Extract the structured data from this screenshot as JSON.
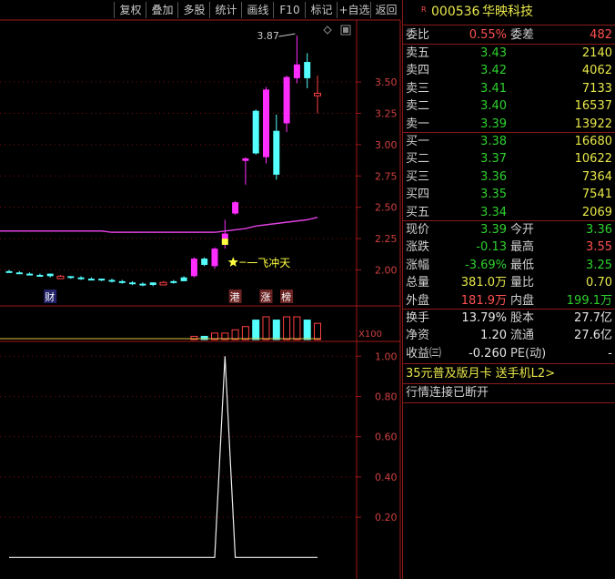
{
  "toolbar": {
    "buttons": [
      "复权",
      "叠加",
      "多股",
      "统计",
      "画线",
      "F10",
      "标记",
      "+自选",
      "返回"
    ]
  },
  "stock": {
    "prefix": "R",
    "code": "000536",
    "name": "华映科技"
  },
  "ratio": {
    "label": "委比",
    "value": "0.55%",
    "diff_label": "委差",
    "diff_value": "482"
  },
  "sell": [
    {
      "label": "卖五",
      "price": "3.43",
      "volume": "2140"
    },
    {
      "label": "卖四",
      "price": "3.42",
      "volume": "4062"
    },
    {
      "label": "卖三",
      "price": "3.41",
      "volume": "7133"
    },
    {
      "label": "卖二",
      "price": "3.40",
      "volume": "16537"
    },
    {
      "label": "卖一",
      "price": "3.39",
      "volume": "13922"
    }
  ],
  "buy": [
    {
      "label": "买一",
      "price": "3.38",
      "volume": "16680"
    },
    {
      "label": "买二",
      "price": "3.37",
      "volume": "10622"
    },
    {
      "label": "买三",
      "price": "3.36",
      "volume": "7364"
    },
    {
      "label": "买四",
      "price": "3.35",
      "volume": "7541"
    },
    {
      "label": "买五",
      "price": "3.34",
      "volume": "2069"
    }
  ],
  "stats": [
    {
      "l1": "现价",
      "v1": "3.39",
      "c1": "green",
      "l2": "今开",
      "v2": "3.36",
      "c2": "green"
    },
    {
      "l1": "涨跌",
      "v1": "-0.13",
      "c1": "green",
      "l2": "最高",
      "v2": "3.55",
      "c2": "red"
    },
    {
      "l1": "涨幅",
      "v1": "-3.69%",
      "c1": "green",
      "l2": "最低",
      "v2": "3.25",
      "c2": "green"
    },
    {
      "l1": "总量",
      "v1": "381.0万",
      "c1": "yellow",
      "l2": "量比",
      "v2": "0.70",
      "c2": "yellow"
    },
    {
      "l1": "外盘",
      "v1": "181.9万",
      "c1": "red",
      "l2": "内盘",
      "v2": "199.1万",
      "c2": "green"
    }
  ],
  "fundamentals": [
    {
      "l1": "换手",
      "v1": "13.79%",
      "l2": "股本",
      "v2": "27.7亿"
    },
    {
      "l1": "净资",
      "v1": "1.20",
      "l2": "流通",
      "v2": "27.6亿"
    },
    {
      "l1": "收益㈢",
      "v1": "-0.260",
      "l2": "PE(动)",
      "v2": "-"
    }
  ],
  "promo": "35元普及版月卡 送手机L2>",
  "status": "行情连接已断开",
  "chart_data": {
    "type": "candlestick",
    "price_axis": {
      "ticks": [
        "3.50",
        "3.25",
        "3.00",
        "2.75",
        "2.50",
        "2.25",
        "2.00"
      ],
      "range": [
        1.72,
        3.98
      ]
    },
    "candles": [
      {
        "o": 1.99,
        "c": 1.99,
        "h": 2.0,
        "l": 1.98
      },
      {
        "o": 1.98,
        "c": 1.98,
        "h": 1.99,
        "l": 1.97
      },
      {
        "o": 1.97,
        "c": 1.97,
        "h": 1.98,
        "l": 1.96
      },
      {
        "o": 1.96,
        "c": 1.96,
        "h": 1.97,
        "l": 1.95
      },
      {
        "o": 1.97,
        "c": 1.95,
        "h": 1.97,
        "l": 1.94
      },
      {
        "o": 1.93,
        "c": 1.95,
        "h": 1.96,
        "l": 1.93
      },
      {
        "o": 1.95,
        "c": 1.94,
        "h": 1.95,
        "l": 1.93
      },
      {
        "o": 1.94,
        "c": 1.93,
        "h": 1.95,
        "l": 1.92
      },
      {
        "o": 1.93,
        "c": 1.93,
        "h": 1.94,
        "l": 1.92
      },
      {
        "o": 1.93,
        "c": 1.92,
        "h": 1.93,
        "l": 1.91
      },
      {
        "o": 1.92,
        "c": 1.91,
        "h": 1.93,
        "l": 1.9
      },
      {
        "o": 1.91,
        "c": 1.9,
        "h": 1.92,
        "l": 1.89
      },
      {
        "o": 1.9,
        "c": 1.89,
        "h": 1.91,
        "l": 1.88
      },
      {
        "o": 1.89,
        "c": 1.88,
        "h": 1.9,
        "l": 1.87
      },
      {
        "o": 1.9,
        "c": 1.88,
        "h": 1.9,
        "l": 1.87
      },
      {
        "o": 1.88,
        "c": 1.9,
        "h": 1.91,
        "l": 1.88
      },
      {
        "o": 1.9,
        "c": 1.91,
        "h": 1.92,
        "l": 1.89
      },
      {
        "o": 1.91,
        "c": 1.94,
        "h": 1.95,
        "l": 1.91
      },
      {
        "o": 1.95,
        "c": 2.09,
        "h": 2.1,
        "l": 1.94
      },
      {
        "o": 2.09,
        "c": 2.04,
        "h": 2.1,
        "l": 2.03
      },
      {
        "o": 2.03,
        "c": 2.17,
        "h": 2.18,
        "l": 2.01
      },
      {
        "o": 2.2,
        "c": 2.29,
        "h": 2.4,
        "l": 2.17
      },
      {
        "o": 2.45,
        "c": 2.54,
        "h": 2.55,
        "l": 2.44
      },
      {
        "o": 2.87,
        "c": 2.89,
        "h": 2.9,
        "l": 2.68
      },
      {
        "o": 2.93,
        "c": 3.27,
        "h": 3.28,
        "l": 2.92
      },
      {
        "o": 2.9,
        "c": 3.44,
        "h": 3.46,
        "l": 2.85
      },
      {
        "o": 2.76,
        "c": 3.11,
        "h": 3.24,
        "l": 2.72
      },
      {
        "o": 3.17,
        "c": 3.54,
        "h": 3.55,
        "l": 3.1
      },
      {
        "o": 3.53,
        "c": 3.64,
        "h": 3.87,
        "l": 3.49
      },
      {
        "o": 3.66,
        "c": 3.53,
        "h": 3.73,
        "l": 3.45
      },
      {
        "o": 3.41,
        "c": 3.39,
        "h": 3.55,
        "l": 3.25
      }
    ],
    "candle_colors": [
      "cyan",
      "cyan",
      "cyan",
      "cyan",
      "cyan",
      "red",
      "cyan",
      "cyan",
      "cyan",
      "cyan",
      "cyan",
      "cyan",
      "cyan",
      "cyan",
      "cyan",
      "red",
      "cyan",
      "cyan",
      "magenta",
      "cyan",
      "magenta",
      "yellow-magenta",
      "magenta",
      "magenta",
      "cyan",
      "magenta",
      "cyan",
      "magenta",
      "magenta",
      "cyan",
      "red"
    ],
    "ma_line": [
      2.31,
      2.31,
      2.31,
      2.31,
      2.31,
      2.31,
      2.31,
      2.31,
      2.31,
      2.31,
      2.3,
      2.3,
      2.3,
      2.3,
      2.3,
      2.3,
      2.3,
      2.3,
      2.3,
      2.3,
      2.3,
      2.31,
      2.32,
      2.33,
      2.35,
      2.36,
      2.37,
      2.38,
      2.39,
      2.4,
      2.42
    ],
    "high_label": "3.87",
    "signal_label": "一飞冲天",
    "signal_candle": 21,
    "markers": [
      {
        "text": "财",
        "candle": 4
      },
      {
        "text": "港",
        "candle": 22
      },
      {
        "text": "涨",
        "candle": 25
      },
      {
        "text": "榜",
        "candle": 27
      }
    ],
    "volume_label": "X100",
    "volume": [
      0,
      0,
      0,
      0,
      0,
      0,
      0,
      0,
      0,
      0,
      0,
      0,
      0,
      0,
      0,
      0,
      0,
      0,
      1,
      1,
      2,
      2,
      3,
      4,
      6,
      7,
      6,
      7,
      7,
      6,
      5
    ],
    "indicator_axis": {
      "ticks": [
        "1.00",
        "0.80",
        "0.60",
        "0.40",
        "0.20"
      ],
      "range": [
        -0.08,
        1.06
      ]
    },
    "indicator": [
      0,
      0,
      0,
      0,
      0,
      0,
      0,
      0,
      0,
      0,
      0,
      0,
      0,
      0,
      0,
      0,
      0,
      0,
      0,
      0,
      0,
      1,
      0,
      0,
      0,
      0,
      0,
      0,
      0,
      0,
      0
    ]
  }
}
